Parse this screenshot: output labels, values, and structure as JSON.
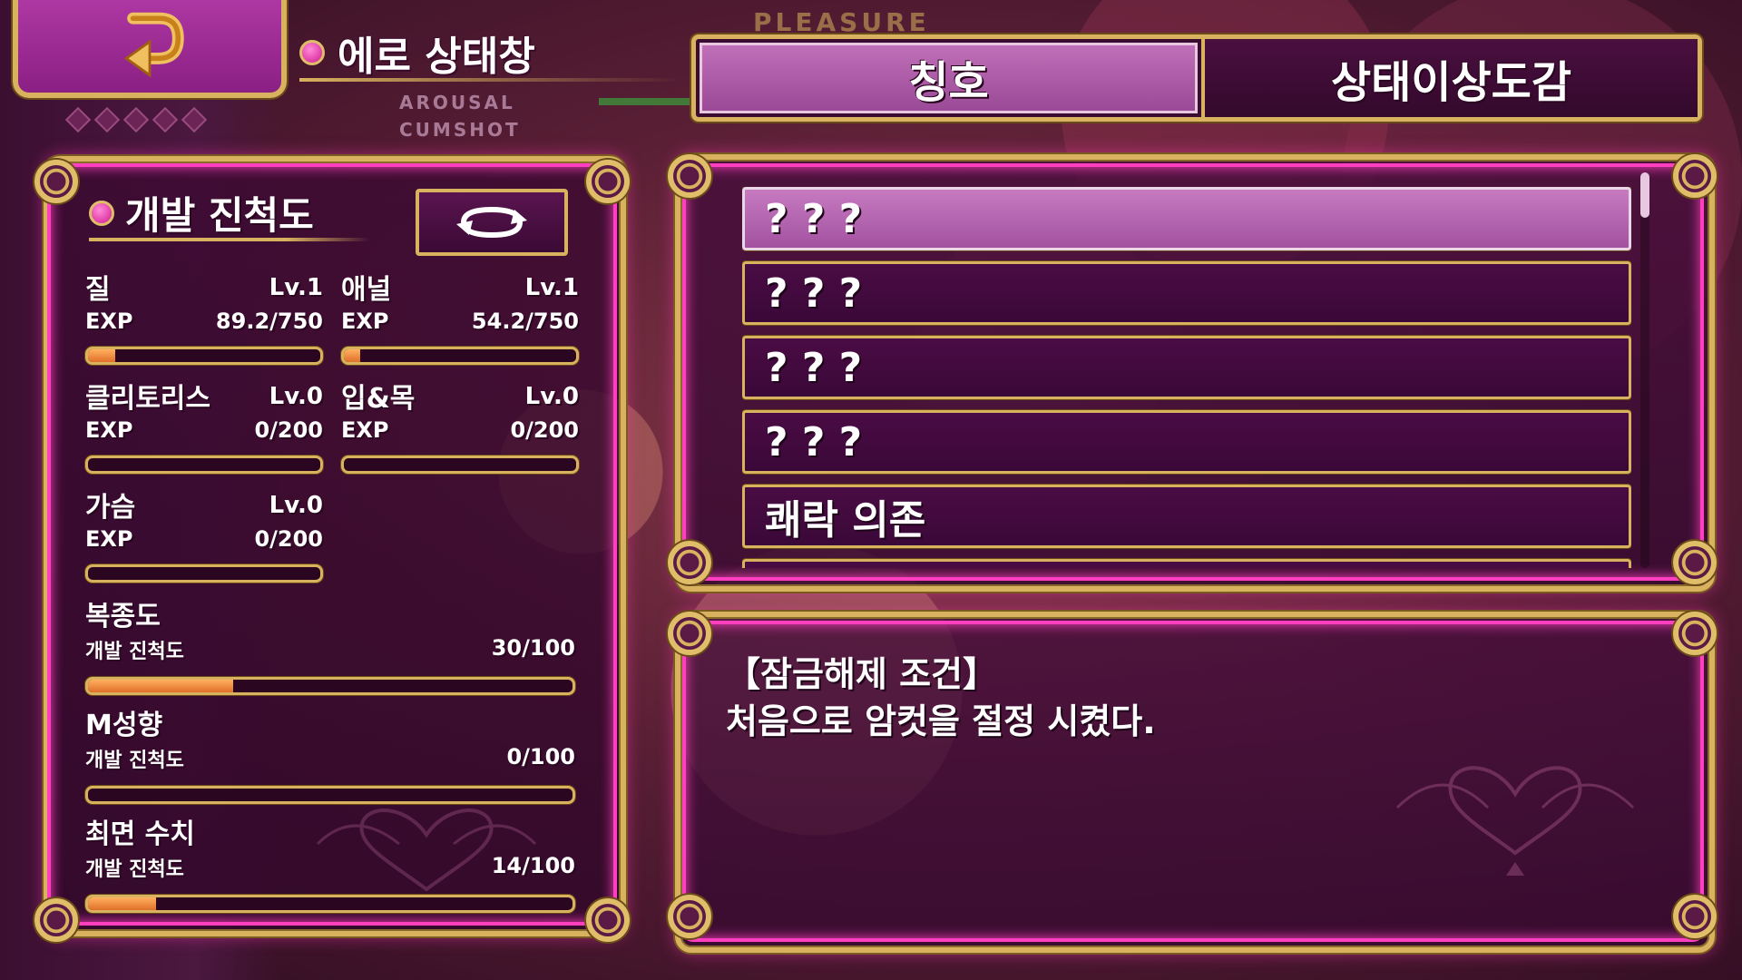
{
  "header": {
    "title": "에로 상태창",
    "back_icon": "return-arrow-icon",
    "bar_label_1": "AROUSAL",
    "bar_label_2": "CUMSHOT",
    "top_deco": "PLEASURE"
  },
  "tabs": [
    {
      "label": "칭호",
      "active": true
    },
    {
      "label": "상태이상도감",
      "active": false
    }
  ],
  "development": {
    "title": "개발 진척도",
    "refresh_icon": "refresh-cycle-icon",
    "stats": [
      {
        "name": "질",
        "level": "Lv.1",
        "exp_label": "EXP",
        "exp": "89.2/750",
        "progress": 0.119
      },
      {
        "name": "애널",
        "level": "Lv.1",
        "exp_label": "EXP",
        "exp": "54.2/750",
        "progress": 0.072
      },
      {
        "name": "클리토리스",
        "level": "Lv.0",
        "exp_label": "EXP",
        "exp": "0/200",
        "progress": 0
      },
      {
        "name": "입&목",
        "level": "Lv.0",
        "exp_label": "EXP",
        "exp": "0/200",
        "progress": 0
      },
      {
        "name": "가슴",
        "level": "Lv.0",
        "exp_label": "EXP",
        "exp": "0/200",
        "progress": 0
      }
    ],
    "gauges": [
      {
        "name": "복종도",
        "sub_label": "개발 진척도",
        "value": "30/100",
        "progress": 0.3
      },
      {
        "name": "M성향",
        "sub_label": "개발 진척도",
        "value": "0/100",
        "progress": 0
      },
      {
        "name": "최면 수치",
        "sub_label": "개발 진척도",
        "value": "14/100",
        "progress": 0.14
      }
    ]
  },
  "titles_list": [
    {
      "label": "? ? ?",
      "selected": true
    },
    {
      "label": "? ? ?",
      "selected": false
    },
    {
      "label": "? ? ?",
      "selected": false
    },
    {
      "label": "? ? ?",
      "selected": false
    },
    {
      "label": "쾌락 의존",
      "selected": false
    },
    {
      "label": "? ? ?",
      "selected": false
    }
  ],
  "description": {
    "title": "【잠금해제 조건】",
    "text": "처음으로 암컷을 절정 시켰다."
  },
  "colors": {
    "gold": "#d8b25e",
    "neon_pink": "#ff3fbf",
    "panel": "#3a0838",
    "selected": "#a352a0",
    "bar_fill": "#e0702a"
  }
}
